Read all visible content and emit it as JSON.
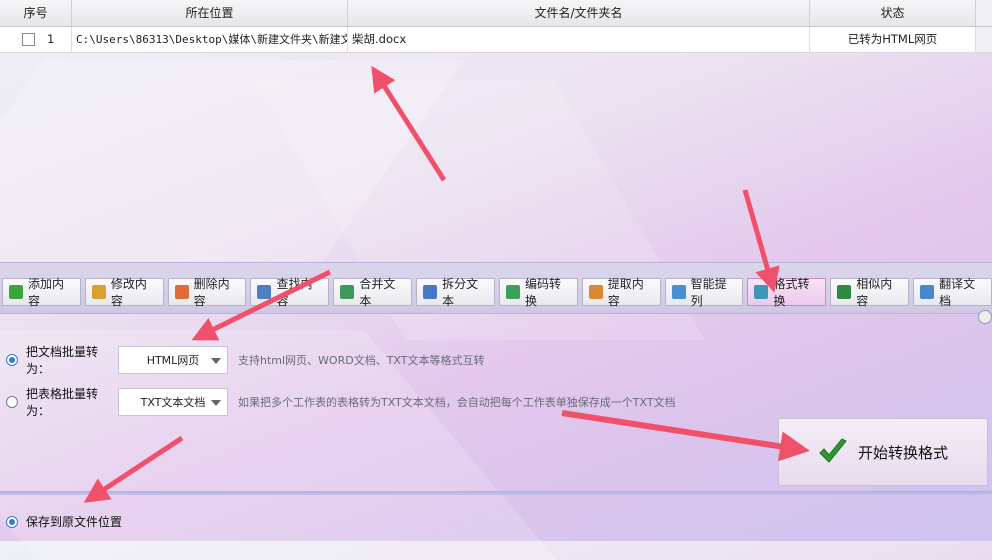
{
  "table": {
    "headers": [
      "序号",
      "所在位置",
      "文件名/文件夹名",
      "状态"
    ],
    "rows": [
      {
        "index": "1",
        "location": "C:\\Users\\86313\\Desktop\\媒体\\新建文件夹\\新建文",
        "filename": "柴胡.docx",
        "status": "已转为HTML网页"
      }
    ]
  },
  "toolbar": {
    "items": [
      {
        "label": "添加内容",
        "icon": "add-icon",
        "color": "#3aa53a"
      },
      {
        "label": "修改内容",
        "icon": "edit-icon",
        "color": "#d9a130"
      },
      {
        "label": "删除内容",
        "icon": "delete-icon",
        "color": "#e06a3a"
      },
      {
        "label": "查找内容",
        "icon": "find-icon",
        "color": "#4d7fc4"
      },
      {
        "label": "合并文本",
        "icon": "merge-icon",
        "color": "#3e9a5a"
      },
      {
        "label": "拆分文本",
        "icon": "split-icon",
        "color": "#4a78c8"
      },
      {
        "label": "编码转换",
        "icon": "encode-icon",
        "color": "#3aa05a"
      },
      {
        "label": "提取内容",
        "icon": "extract-icon",
        "color": "#d98a30"
      },
      {
        "label": "智能提列",
        "icon": "smart-icon",
        "color": "#4a8fd0"
      },
      {
        "label": "格式转换",
        "icon": "format-icon",
        "color": "#3d98b8",
        "active": true
      },
      {
        "label": "相似内容",
        "icon": "similar-icon",
        "color": "#2e8a3e"
      },
      {
        "label": "翻译文档",
        "icon": "translate-icon",
        "color": "#4a86cc"
      }
    ]
  },
  "options": {
    "doc": {
      "label": "把文档批量转为：",
      "selected": "HTML网页",
      "hint": "支持html网页、WORD文档、TXT文本等格式互转",
      "checked": true
    },
    "sheet": {
      "label": "把表格批量转为：",
      "selected": "TXT文本文档",
      "hint": "如果把多个工作表的表格转为TXT文本文档，会自动把每个工作表单独保存成一个TXT文档",
      "checked": false
    }
  },
  "start_button": {
    "label": "开始转换格式"
  },
  "save": {
    "label": "保存到原文件位置",
    "checked": true
  },
  "colors": {
    "accent": "#2f7bd9",
    "annotation_arrow": "#f0506a",
    "checkmark": "#2e9a2e"
  }
}
